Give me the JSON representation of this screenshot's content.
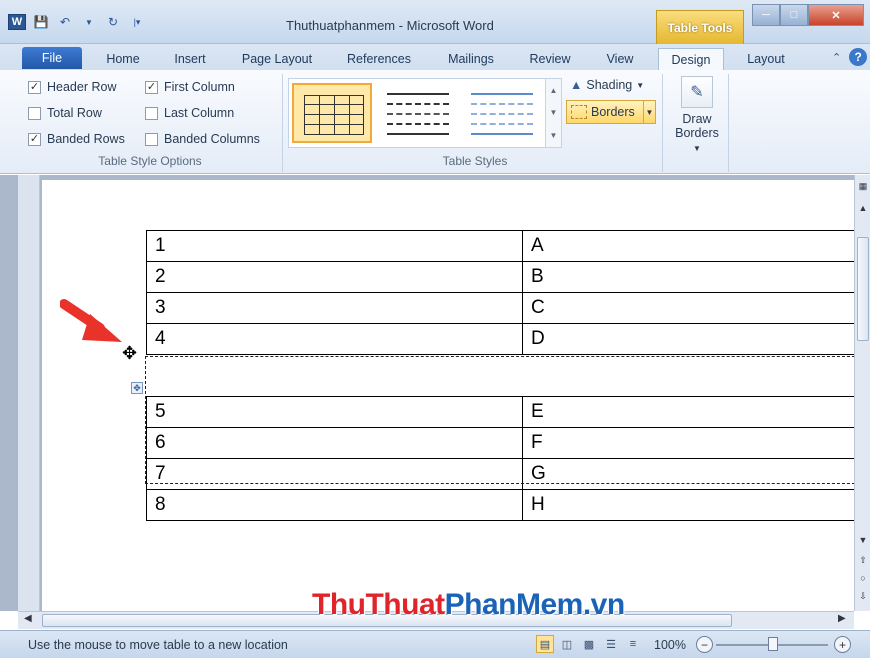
{
  "window": {
    "title": "Thuthuatphanmem - Microsoft Word",
    "context_tab_group": "Table Tools",
    "app_icon": "W"
  },
  "tabs": {
    "file": "File",
    "items": [
      "Home",
      "Insert",
      "Page Layout",
      "References",
      "Mailings",
      "Review",
      "View",
      "Design",
      "Layout"
    ],
    "active": "Design"
  },
  "ribbon": {
    "style_options": {
      "header_row": "Header Row",
      "first_column": "First Column",
      "total_row": "Total Row",
      "last_column": "Last Column",
      "banded_rows": "Banded Rows",
      "banded_columns": "Banded Columns",
      "group_label": "Table Style Options",
      "checked": {
        "header_row": true,
        "first_column": true,
        "total_row": false,
        "last_column": false,
        "banded_rows": true,
        "banded_columns": false
      }
    },
    "table_styles": {
      "group_label": "Table Styles",
      "shading": "Shading",
      "borders": "Borders"
    },
    "draw_borders": {
      "line1": "Draw",
      "line2": "Borders"
    }
  },
  "document": {
    "rows_top": [
      {
        "c1": "1",
        "c2": "A"
      },
      {
        "c1": "2",
        "c2": "B"
      },
      {
        "c1": "3",
        "c2": "C"
      },
      {
        "c1": "4",
        "c2": "D"
      }
    ],
    "rows_bottom": [
      {
        "c1": "5",
        "c2": "E"
      },
      {
        "c1": "6",
        "c2": "F"
      },
      {
        "c1": "7",
        "c2": "G"
      },
      {
        "c1": "8",
        "c2": "H"
      }
    ]
  },
  "watermark": {
    "part1": "ThuThuat",
    "part2": "PhanMem",
    "part3": ".vn"
  },
  "status": {
    "text": "Use the mouse to move table to a new location",
    "zoom": "100%"
  },
  "colors": {
    "accent": "#2b579a",
    "table_tools": "#e6b730",
    "arrow": "#e8322a"
  }
}
